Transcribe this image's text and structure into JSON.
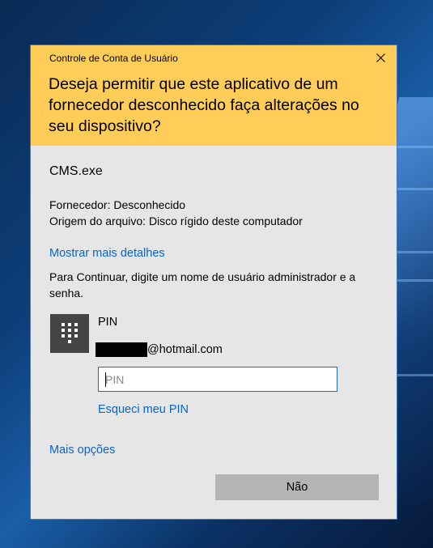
{
  "window": {
    "title": "Controle de Conta de Usuário",
    "close_icon": "close-icon"
  },
  "header": {
    "question": "Deseja permitir que este aplicativo de um fornecedor desconhecido faça alterações no seu dispositivo?",
    "background_color": "#ffcd58"
  },
  "app": {
    "name": "CMS.exe",
    "publisher": "Fornecedor: Desconhecido",
    "origin": "Origem do arquivo: Disco rígido deste computador"
  },
  "links": {
    "more_details": "Mostrar mais detalhes",
    "forgot_pin": "Esqueci meu PIN",
    "more_options": "Mais opções"
  },
  "instruction": "Para Continuar, digite um nome de usuário administrador e a senha.",
  "credential": {
    "tile_icon": "keypad-icon",
    "label": "PIN",
    "account_suffix": "@hotmail.com",
    "pin_placeholder": "PIN",
    "pin_value": ""
  },
  "buttons": {
    "no_label": "Não"
  },
  "colors": {
    "link": "#0a64c8",
    "dialog_border": "#3b78c4",
    "input_border": "#1b6fc8"
  }
}
